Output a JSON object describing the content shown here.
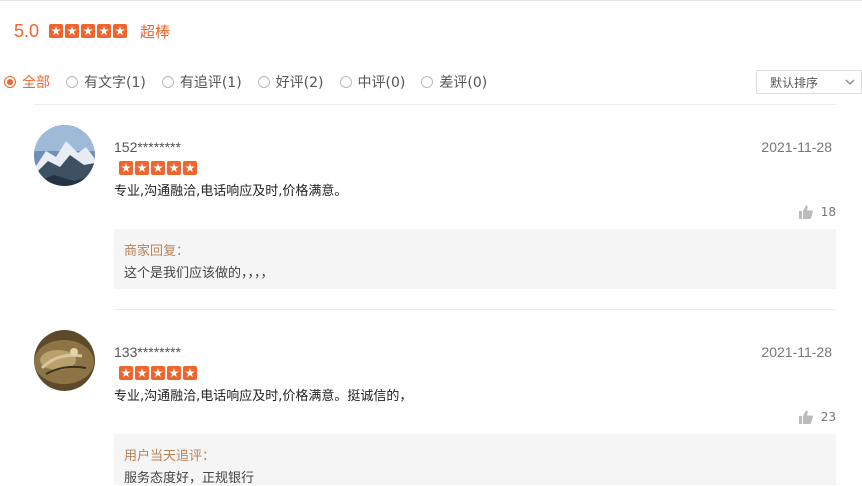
{
  "summary": {
    "score": "5.0",
    "rating_word": "超棒",
    "star_color": "#f0652d"
  },
  "filters": [
    {
      "label": "全部",
      "active": true
    },
    {
      "label": "有文字(1)",
      "active": false
    },
    {
      "label": "有追评(1)",
      "active": false
    },
    {
      "label": "好评(2)",
      "active": false
    },
    {
      "label": "中评(0)",
      "active": false
    },
    {
      "label": "差评(0)",
      "active": false
    }
  ],
  "sort": {
    "selected": "默认排序"
  },
  "reviews": [
    {
      "user": "152********",
      "date": "2021-11-28",
      "stars": 5,
      "content": "专业,沟通融洽,电话响应及时,价格满意。",
      "likes": "18",
      "reply_label": "商家回复：",
      "reply_text": "这个是我们应该做的，，，，"
    },
    {
      "user": "133********",
      "date": "2021-11-28",
      "stars": 5,
      "content": "专业,沟通融洽,电话响应及时,价格满意。挺诚信的，",
      "likes": "23",
      "reply_label": "用户当天追评：",
      "reply_text": "服务态度好，正规银行"
    }
  ]
}
